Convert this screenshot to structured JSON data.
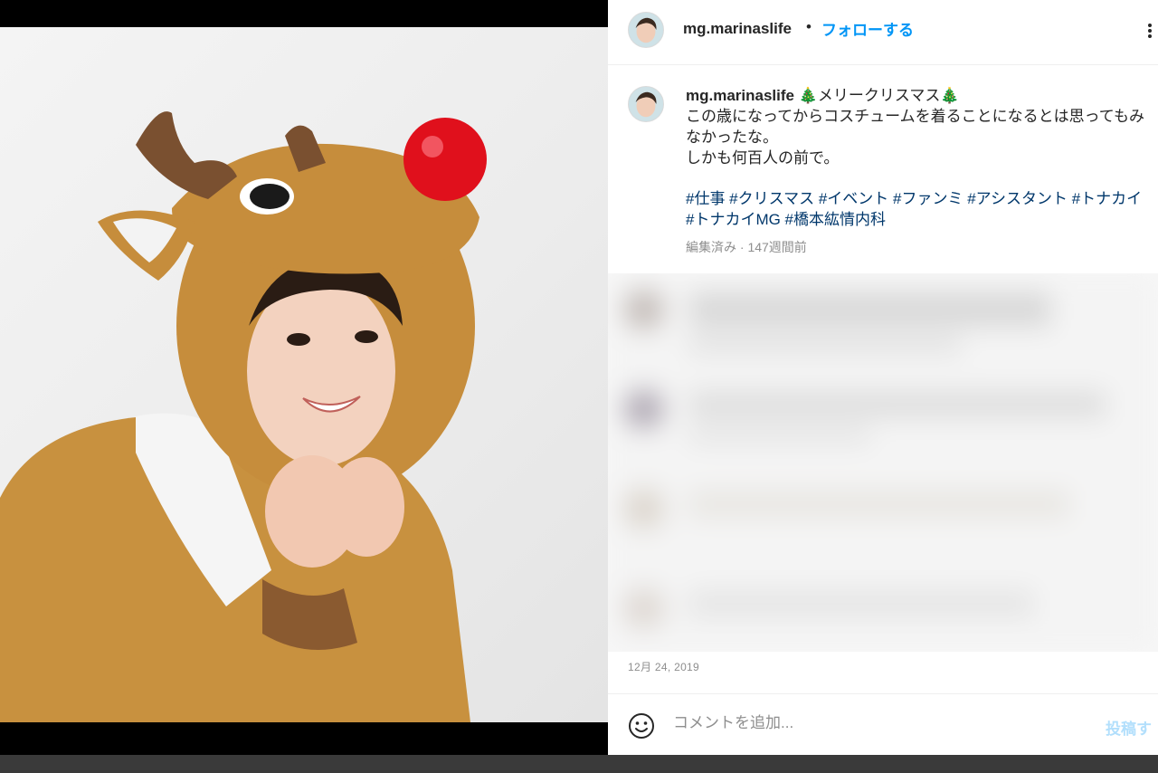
{
  "post": {
    "username": "mg.marinaslife",
    "follow_label": "フォローする",
    "header_separator": "•",
    "caption_title": "🎄メリークリスマス🎄",
    "caption_lines": [
      "この歳になってからコスチュームを着ることになるとは思ってもみなかったな。",
      "しかも何百人の前で。"
    ],
    "hashtags": "#仕事 #クリスマス #イベント #ファンミ #アシスタント #トナカイ #トナカイMG #橋本紘情内科",
    "meta": "編集済み · 147週間前",
    "date": "12月 24, 2019"
  },
  "comment": {
    "placeholder": "コメントを追加...",
    "post_label": "投稿す"
  },
  "icons": {
    "more": "more-options-icon",
    "emoji": "emoji-icon"
  },
  "colors": {
    "accent": "#0095f6",
    "hashtag": "#00376b",
    "muted": "#8e8e8e",
    "costume": "#c8913f",
    "nose": "#e0101c"
  }
}
